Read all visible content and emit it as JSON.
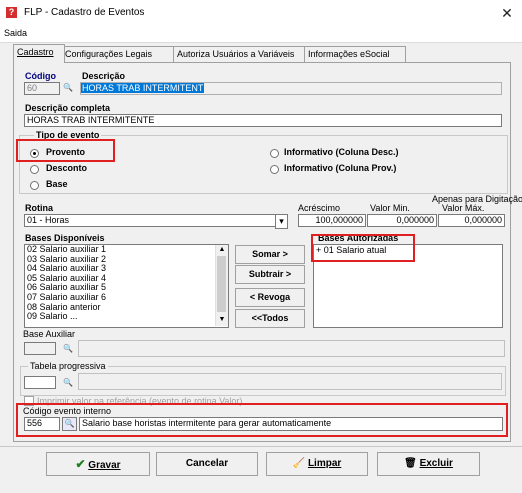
{
  "window": {
    "title": "FLP - Cadastro de Eventos",
    "close_glyph": "✕"
  },
  "menu": {
    "saida": "Saida"
  },
  "tabs": [
    {
      "label": "Cadastro"
    },
    {
      "label": "Configurações Legais"
    },
    {
      "label": "Autoriza Usuários a Variáveis"
    },
    {
      "label": "Informações eSocial"
    }
  ],
  "codigo": {
    "label": "Código",
    "value": "60",
    "search_glyph": "🔍"
  },
  "descricao": {
    "label": "Descrição",
    "value": "HORAS TRAB INTERMITENT"
  },
  "descricao_completa": {
    "label": "Descrição completa",
    "value": "HORAS TRAB INTERMITENTE"
  },
  "tipo_evento": {
    "label": "Tipo de evento",
    "options": {
      "provento": "Provento",
      "desconto": "Desconto",
      "base": "Base",
      "info_desc": "Informativo (Coluna Desc.)",
      "info_prov": "Informativo (Coluna Prov.)"
    },
    "selected": "Provento"
  },
  "rotina": {
    "label": "Rotina",
    "value": "01 - Horas",
    "dropdown_glyph": "▾"
  },
  "apenas_para_digitacao": "Apenas para Digitação",
  "acrescimo": {
    "label": "Acréscimo",
    "value": "100,000000"
  },
  "valor_min": {
    "label": "Valor Min.",
    "value": "0,000000"
  },
  "valor_max": {
    "label": "Valor Máx.",
    "value": "0,000000"
  },
  "bases_disponiveis": {
    "label": "Bases Disponíveis",
    "items": [
      "02 Salario auxiliar 1",
      "03 Salario auxiliar 2",
      "04 Salario auxiliar 3",
      "05 Salario auxiliar 4",
      "06 Salario auxiliar 5",
      "07 Salario auxiliar 6",
      "08 Salario anterior",
      "09 Salario ..."
    ],
    "scroll_up": "▲",
    "scroll_down": "▼"
  },
  "transfer_buttons": {
    "somar": "Somar >",
    "subtrair": "Subtrair >",
    "revoga": "< Revoga",
    "todos": "<<Todos"
  },
  "bases_autorizadas": {
    "label": "Bases Autorizadas",
    "items": [
      "+ 01 Salario atual"
    ]
  },
  "base_auxiliar": {
    "label": "Base Auxiliar",
    "value": ""
  },
  "tabela_progressiva": {
    "label": "Tabela progressiva",
    "value": ""
  },
  "imprimir_valor": {
    "label": "Imprimir valor na referência (evento de rotina Valor)"
  },
  "codigo_evento_interno": {
    "label": "Código evento interno",
    "value": "556",
    "description": "Salario base horistas intermitente para gerar automaticamente"
  },
  "footer": {
    "gravar": "Gravar",
    "cancelar": "Cancelar",
    "limpar": "Limpar",
    "excluir": "Excluir",
    "gravar_glyph": "✔",
    "limpar_glyph": "🧹",
    "excluir_glyph": "🗑"
  },
  "colors": {
    "highlight_red": "#e02020",
    "selection_blue": "#0078d7",
    "label_blue": "#000080"
  }
}
